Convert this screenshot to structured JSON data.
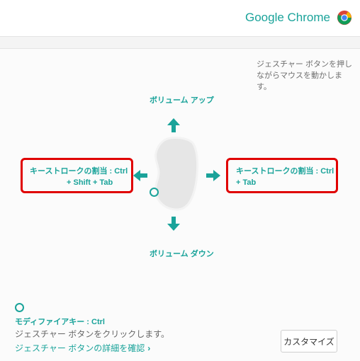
{
  "header": {
    "app_name": "Google Chrome",
    "logo_icon": "chrome-logo-icon"
  },
  "gesture": {
    "hint": "ジェスチャー ボタンを押しながらマウスを動かします。",
    "up_label": "ボリューム アップ",
    "down_label": "ボリューム ダウン",
    "left_line1": "キーストロークの割当 : Ctrl",
    "left_line2": "+ Shift + Tab",
    "right_line1": "キーストロークの割当 : Ctrl",
    "right_line2": "+ Tab"
  },
  "modifier": {
    "label": "モディファイアキー : Ctrl",
    "description": "ジェスチャー ボタンをクリックします。",
    "details_link": "ジェスチャー ボタンの詳細を確認",
    "chevron": "›"
  },
  "buttons": {
    "customize": "カスタマイズ"
  },
  "colors": {
    "accent": "#1aa39a",
    "highlight": "#e00000",
    "background": "#f4f4f4"
  }
}
